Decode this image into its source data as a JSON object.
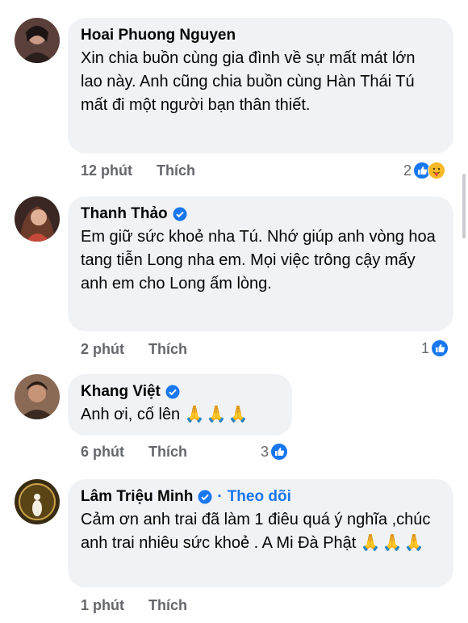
{
  "comments": [
    {
      "author": "Hoai Phuong Nguyen",
      "text": "Xin chia buồn cùng gia đình về sự mất mát lớn lao này. Anh cũng chia buồn cùng Hàn Thái Tú mất đi một người bạn thân thiết.",
      "time": "12 phút",
      "like_label": "Thích",
      "reaction_count": "2",
      "reactions": [
        "like-icon",
        "care-icon"
      ]
    },
    {
      "author": "Thanh Thảo",
      "verified": true,
      "text": "Em giữ sức khoẻ nha Tú. Nhớ giúp anh vòng hoa tang tiễn Long nha em. Mọi việc trông cậy mấy anh em cho Long ấm lòng.",
      "time": "2 phút",
      "like_label": "Thích",
      "reaction_count": "1",
      "reactions": [
        "like-icon"
      ]
    },
    {
      "author": "Khang Việt",
      "verified": true,
      "text": "Anh ơi, cố lên",
      "emoji": "🙏🙏🙏",
      "time": "6 phút",
      "like_label": "Thích",
      "reaction_count": "3",
      "reactions": [
        "like-icon"
      ]
    },
    {
      "author": "Lâm Triệu Minh",
      "verified": true,
      "separator": "·",
      "follow_label": "Theo dõi",
      "text": "Cảm ơn anh trai đã làm 1 điêu quá ý nghĩa ,chúc anh trai nhiêu sức khoẻ . A Mi Đà Phật",
      "emoji": "🙏🙏🙏",
      "time": "1 phút",
      "like_label": "Thích"
    }
  ],
  "colors": {
    "bubble": "#f0f2f5",
    "link": "#1877f2",
    "meta": "#65676b"
  }
}
